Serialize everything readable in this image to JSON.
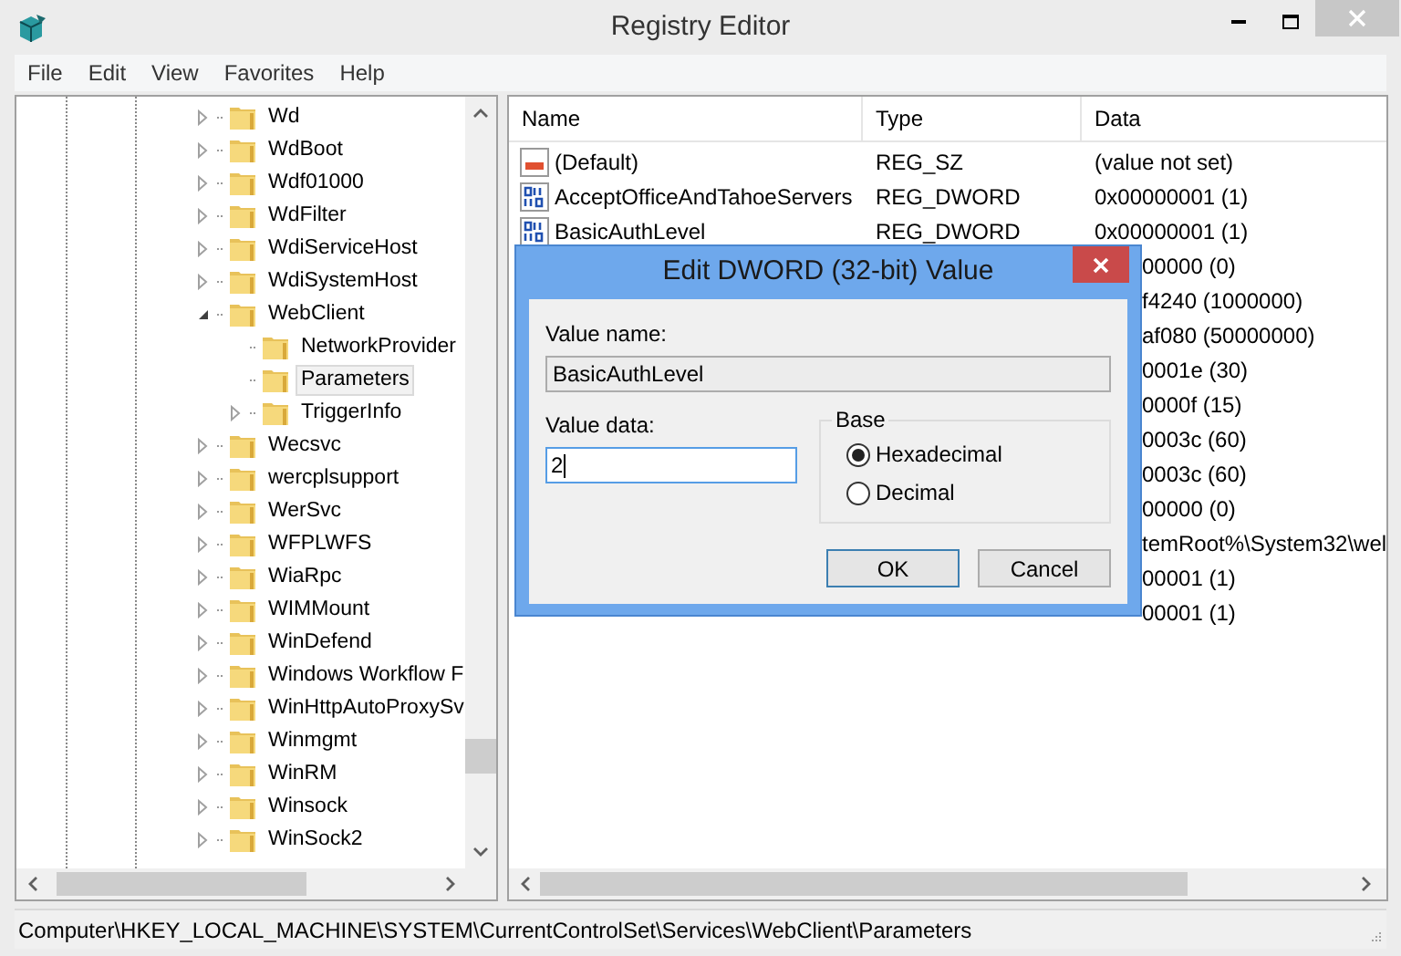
{
  "window": {
    "title": "Registry Editor"
  },
  "menu": [
    "File",
    "Edit",
    "View",
    "Favorites",
    "Help"
  ],
  "tree": {
    "items": [
      {
        "label": "Wd",
        "has_children": true,
        "expanded": false,
        "selected": false
      },
      {
        "label": "WdBoot",
        "has_children": true,
        "expanded": false,
        "selected": false
      },
      {
        "label": "Wdf01000",
        "has_children": true,
        "expanded": false,
        "selected": false
      },
      {
        "label": "WdFilter",
        "has_children": true,
        "expanded": false,
        "selected": false
      },
      {
        "label": "WdiServiceHost",
        "has_children": true,
        "expanded": false,
        "selected": false
      },
      {
        "label": "WdiSystemHost",
        "has_children": true,
        "expanded": false,
        "selected": false
      },
      {
        "label": "WebClient",
        "has_children": true,
        "expanded": true,
        "selected": false,
        "children": [
          {
            "label": "NetworkProvider",
            "has_children": false,
            "expanded": false,
            "selected": false
          },
          {
            "label": "Parameters",
            "has_children": false,
            "expanded": false,
            "selected": true
          },
          {
            "label": "TriggerInfo",
            "has_children": true,
            "expanded": false,
            "selected": false
          }
        ]
      },
      {
        "label": "Wecsvc",
        "has_children": true,
        "expanded": false,
        "selected": false
      },
      {
        "label": "wercplsupport",
        "has_children": true,
        "expanded": false,
        "selected": false
      },
      {
        "label": "WerSvc",
        "has_children": true,
        "expanded": false,
        "selected": false
      },
      {
        "label": "WFPLWFS",
        "has_children": true,
        "expanded": false,
        "selected": false
      },
      {
        "label": "WiaRpc",
        "has_children": true,
        "expanded": false,
        "selected": false
      },
      {
        "label": "WIMMount",
        "has_children": true,
        "expanded": false,
        "selected": false
      },
      {
        "label": "WinDefend",
        "has_children": true,
        "expanded": false,
        "selected": false
      },
      {
        "label": "Windows Workflow F",
        "has_children": true,
        "expanded": false,
        "selected": false
      },
      {
        "label": "WinHttpAutoProxySv",
        "has_children": true,
        "expanded": false,
        "selected": false
      },
      {
        "label": "Winmgmt",
        "has_children": true,
        "expanded": false,
        "selected": false
      },
      {
        "label": "WinRM",
        "has_children": true,
        "expanded": false,
        "selected": false
      },
      {
        "label": "Winsock",
        "has_children": true,
        "expanded": false,
        "selected": false
      },
      {
        "label": "WinSock2",
        "has_children": true,
        "expanded": false,
        "selected": false
      }
    ]
  },
  "values": {
    "columns": [
      "Name",
      "Type",
      "Data"
    ],
    "rows": [
      {
        "kind": "string",
        "name": "(Default)",
        "type": "REG_SZ",
        "data": "(value not set)"
      },
      {
        "kind": "dword",
        "name": "AcceptOfficeAndTahoeServers",
        "type": "REG_DWORD",
        "data": "0x00000001 (1)"
      },
      {
        "kind": "dword",
        "name": "BasicAuthLevel",
        "type": "REG_DWORD",
        "data": "0x00000001 (1)"
      },
      {
        "kind": "partial",
        "data": "00000 (0)"
      },
      {
        "kind": "partial",
        "data": "f4240 (1000000)"
      },
      {
        "kind": "partial",
        "data": "af080 (50000000)"
      },
      {
        "kind": "partial",
        "data": "0001e (30)"
      },
      {
        "kind": "partial",
        "data": "0000f (15)"
      },
      {
        "kind": "partial",
        "data": "0003c (60)"
      },
      {
        "kind": "partial",
        "data": "0003c (60)"
      },
      {
        "kind": "partial",
        "data": "00000 (0)"
      },
      {
        "kind": "partial",
        "data": "temRoot%\\System32\\wel"
      },
      {
        "kind": "partial",
        "data": "00001 (1)"
      },
      {
        "kind": "partial",
        "data": "00001 (1)"
      }
    ]
  },
  "dialog": {
    "title": "Edit DWORD (32-bit) Value",
    "value_name_label": "Value name:",
    "value_name": "BasicAuthLevel",
    "value_data_label": "Value data:",
    "value_data": "2",
    "base_label": "Base",
    "radios": [
      {
        "label": "Hexadecimal",
        "selected": true
      },
      {
        "label": "Decimal",
        "selected": false
      }
    ],
    "buttons": [
      {
        "label": "OK",
        "default": true
      },
      {
        "label": "Cancel",
        "default": false
      }
    ]
  },
  "status_bar": "Computer\\HKEY_LOCAL_MACHINE\\SYSTEM\\CurrentControlSet\\Services\\WebClient\\Parameters"
}
